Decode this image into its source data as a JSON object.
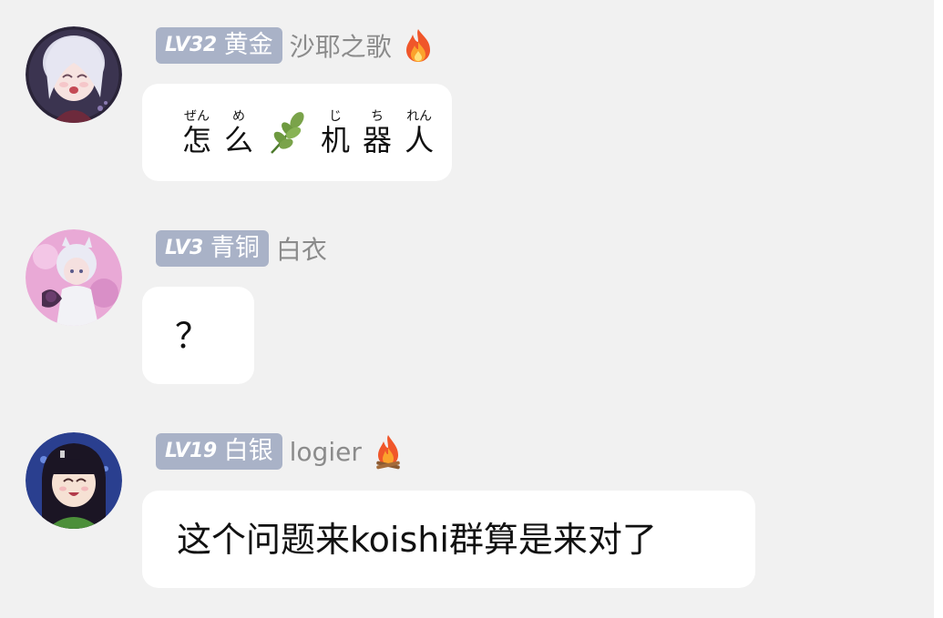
{
  "messages": [
    {
      "level": "LV32",
      "rank": "黄金",
      "username": "沙耶之歌",
      "badge_icon": "fire-icon",
      "content": {
        "segments": [
          {
            "ruby": "ぜん",
            "char": "怎"
          },
          {
            "ruby": "め",
            "char": "么"
          },
          {
            "icon": "leaf-emoji"
          },
          {
            "ruby": "じ",
            "char": "机"
          },
          {
            "ruby": "ち",
            "char": "器"
          },
          {
            "ruby": "れん",
            "char": "人"
          }
        ]
      }
    },
    {
      "level": "LV3",
      "rank": "青铜",
      "username": "白衣",
      "text": "？"
    },
    {
      "level": "LV19",
      "rank": "白银",
      "username": "logier",
      "badge_icon": "campfire-icon",
      "text": "这个问题来koishi群算是来对了"
    }
  ],
  "colors": {
    "background": "#f1f1f1",
    "bubble": "#ffffff",
    "level_badge": "#a9b2c7",
    "username": "#8b8b8b"
  }
}
